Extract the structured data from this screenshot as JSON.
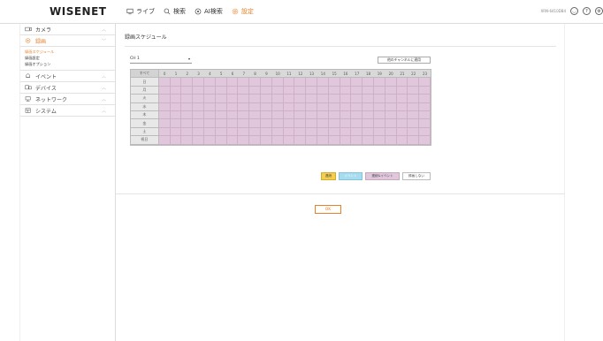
{
  "header": {
    "logo": "WISENET",
    "nav": [
      {
        "label": "ライブ",
        "icon": "monitor-icon",
        "active": false
      },
      {
        "label": "検索",
        "icon": "search-icon",
        "active": false
      },
      {
        "label": "AI検索",
        "icon": "ai-search-icon",
        "active": false
      },
      {
        "label": "設定",
        "icon": "gear-icon",
        "active": true
      }
    ],
    "device": "XRN-6410DB4",
    "accent": "#e8812b"
  },
  "sidebar": {
    "camera": "カメラ",
    "record": "録画",
    "record_items": [
      "録画スケジュール",
      "録画設定",
      "録画オプション"
    ],
    "event": "イベント",
    "device": "デバイス",
    "network": "ネットワーク",
    "system": "システム"
  },
  "main": {
    "title": "録画スケジュール",
    "channel": "CH 1",
    "apply_all": "他のチャンネルに適用",
    "grid": {
      "corner": "すべて",
      "hours": [
        "0",
        "1",
        "2",
        "3",
        "4",
        "5",
        "6",
        "7",
        "8",
        "9",
        "10",
        "11",
        "12",
        "13",
        "14",
        "15",
        "16",
        "17",
        "18",
        "19",
        "20",
        "21",
        "22",
        "23"
      ],
      "days": [
        "日",
        "月",
        "火",
        "水",
        "木",
        "金",
        "土",
        "祝日"
      ],
      "cell_color": "#e1c7dc"
    },
    "legend": {
      "continuous": "連続",
      "event": "イベント",
      "both": "連続&イベント",
      "none": "録画しない"
    },
    "ok": "OK"
  }
}
